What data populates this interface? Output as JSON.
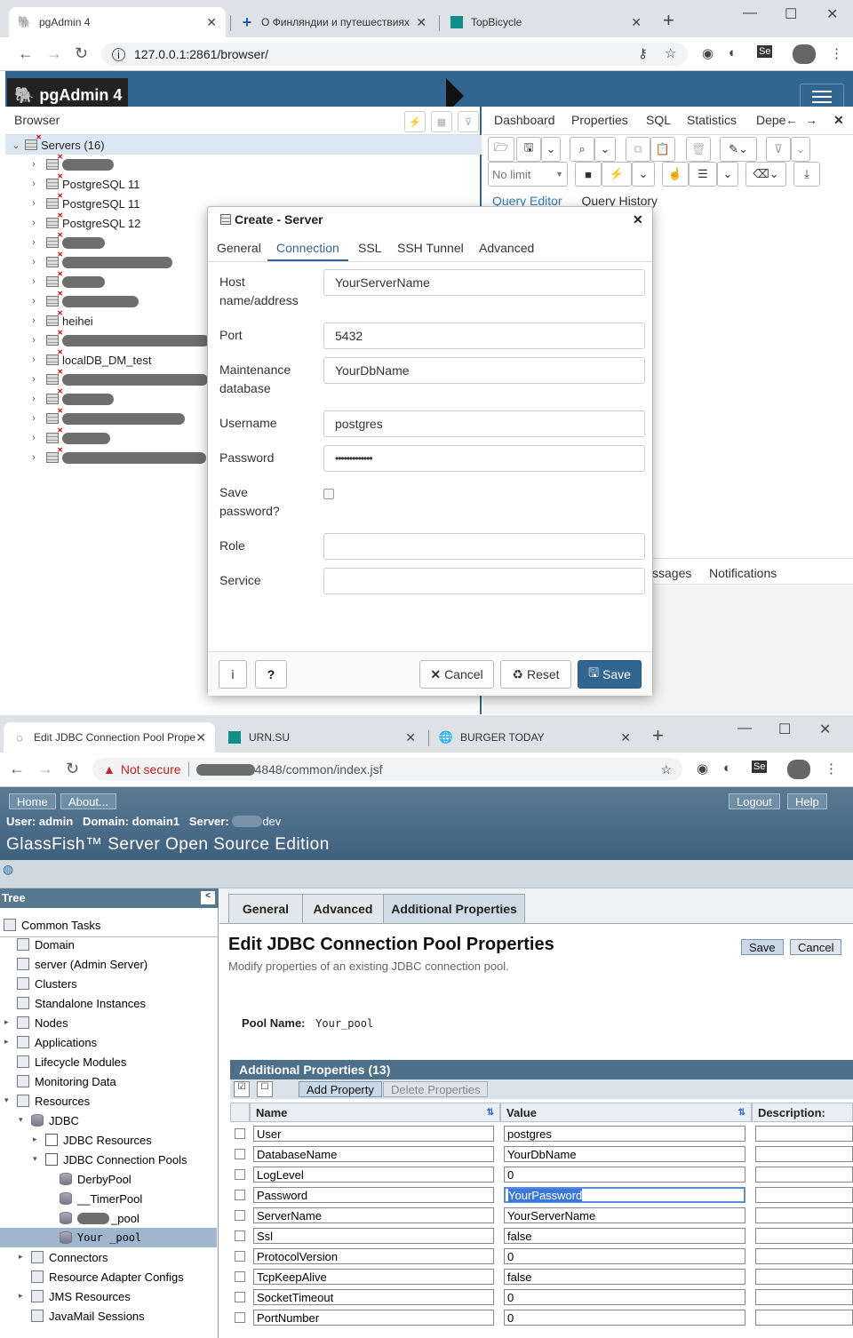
{
  "pg_browser": {
    "tabs": [
      {
        "label": "pgAdmin 4"
      },
      {
        "label": "О Финляндии и путешествиях"
      },
      {
        "label": "TopBicycle"
      }
    ],
    "url": "127.0.0.1:2861/browser/"
  },
  "pgadmin": {
    "logo": "pgAdmin 4",
    "browser_title": "Browser",
    "tree_root": "Servers (16)",
    "servers": [
      "",
      "PostgreSQL 11",
      "PostgreSQL 11",
      "PostgreSQL 12",
      "",
      "",
      "",
      "",
      "heihei",
      "",
      "localDB_DM_test",
      "",
      "",
      "",
      "",
      ""
    ],
    "right_tabs": [
      "Dashboard",
      "Properties",
      "SQL",
      "Statistics",
      "Depe"
    ],
    "no_limit": "No limit",
    "query_tabs": [
      "Query Editor",
      "Query History"
    ],
    "bottom_tabs": [
      "ssages",
      "Notifications"
    ]
  },
  "dialog": {
    "title": "Create - Server",
    "tabs": [
      "General",
      "Connection",
      "SSL",
      "SSH Tunnel",
      "Advanced"
    ],
    "active_tab": "Connection",
    "fields": {
      "host_label": "Host name/address",
      "host_value": "YourServerName",
      "port_label": "Port",
      "port_value": "5432",
      "maint_label": "Maintenance database",
      "maint_value": "YourDbName",
      "user_label": "Username",
      "user_value": "postgres",
      "pass_label": "Password",
      "pass_value": "•••••••••••••",
      "save_label": "Save password?",
      "role_label": "Role",
      "role_value": "",
      "service_label": "Service",
      "service_value": ""
    },
    "buttons": {
      "info": "i",
      "help": "?",
      "cancel": "Cancel",
      "reset": "Reset",
      "save": "Save"
    }
  },
  "gf_browser": {
    "tabs": [
      {
        "label": "Edit JDBC Connection Pool Prope"
      },
      {
        "label": "URN.SU"
      },
      {
        "label": "BURGER TODAY"
      }
    ],
    "not_secure": "Not secure",
    "url": "4848/common/index.jsf"
  },
  "glassfish": {
    "nav": {
      "home": "Home",
      "about": "About...",
      "logout": "Logout",
      "help": "Help"
    },
    "user_info": "User: admin   Domain: domain1   Server:",
    "server_suffix": "dev",
    "product": "GlassFish™ Server Open Source Edition",
    "tree_title": "Tree",
    "tree": [
      {
        "label": "Common Tasks"
      },
      {
        "label": "Domain"
      },
      {
        "label": "server (Admin Server)"
      },
      {
        "label": "Clusters"
      },
      {
        "label": "Standalone Instances"
      },
      {
        "label": "Nodes"
      },
      {
        "label": "Applications"
      },
      {
        "label": "Lifecycle Modules"
      },
      {
        "label": "Monitoring Data"
      },
      {
        "label": "Resources"
      },
      {
        "label": "JDBC"
      },
      {
        "label": "JDBC Resources"
      },
      {
        "label": "JDBC Connection Pools"
      },
      {
        "label": "DerbyPool"
      },
      {
        "label": "__TimerPool"
      },
      {
        "label": "_pool"
      },
      {
        "label": "Your _pool"
      },
      {
        "label": "Connectors"
      },
      {
        "label": "Resource Adapter Configs"
      },
      {
        "label": "JMS Resources"
      },
      {
        "label": "JavaMail Sessions"
      }
    ],
    "page_tabs": [
      "General",
      "Advanced",
      "Additional Properties"
    ],
    "page_title": "Edit JDBC Connection Pool Properties",
    "page_desc": "Modify properties of an existing JDBC connection pool.",
    "save": "Save",
    "cancel": "Cancel",
    "pool_name_label": "Pool Name:",
    "pool_name": "Your_pool",
    "table_title": "Additional Properties (13)",
    "add_property": "Add Property",
    "delete_properties": "Delete Properties",
    "col_name": "Name",
    "col_value": "Value",
    "col_desc": "Description:",
    "rows": [
      {
        "name": "User",
        "value": "postgres"
      },
      {
        "name": "DatabaseName",
        "value": "YourDbName"
      },
      {
        "name": "LogLevel",
        "value": "0"
      },
      {
        "name": "Password",
        "value": "YourPassword"
      },
      {
        "name": "ServerName",
        "value": "YourServerName"
      },
      {
        "name": "Ssl",
        "value": "false"
      },
      {
        "name": "ProtocolVersion",
        "value": "0"
      },
      {
        "name": "TcpKeepAlive",
        "value": "false"
      },
      {
        "name": "SocketTimeout",
        "value": "0"
      },
      {
        "name": "PortNumber",
        "value": "0"
      }
    ]
  }
}
